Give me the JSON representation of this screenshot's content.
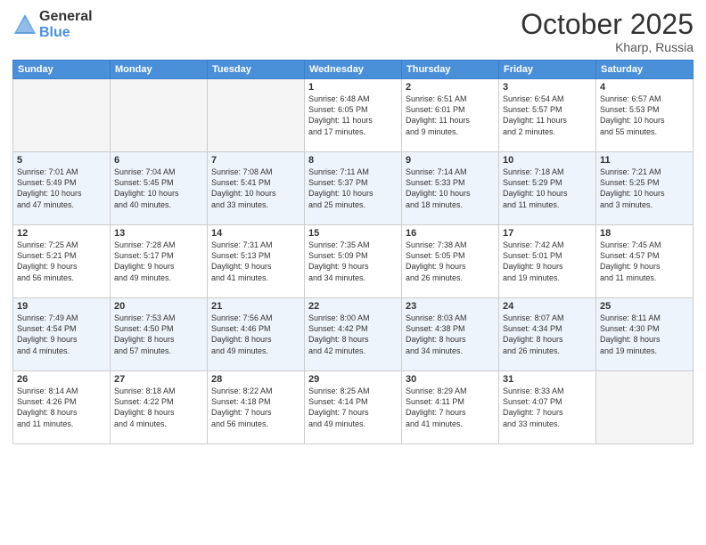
{
  "logo": {
    "general": "General",
    "blue": "Blue"
  },
  "title": "October 2025",
  "subtitle": "Kharp, Russia",
  "days_header": [
    "Sunday",
    "Monday",
    "Tuesday",
    "Wednesday",
    "Thursday",
    "Friday",
    "Saturday"
  ],
  "weeks": [
    {
      "alt": false,
      "days": [
        {
          "num": "",
          "info": ""
        },
        {
          "num": "",
          "info": ""
        },
        {
          "num": "",
          "info": ""
        },
        {
          "num": "1",
          "info": "Sunrise: 6:48 AM\nSunset: 6:05 PM\nDaylight: 11 hours\nand 17 minutes."
        },
        {
          "num": "2",
          "info": "Sunrise: 6:51 AM\nSunset: 6:01 PM\nDaylight: 11 hours\nand 9 minutes."
        },
        {
          "num": "3",
          "info": "Sunrise: 6:54 AM\nSunset: 5:57 PM\nDaylight: 11 hours\nand 2 minutes."
        },
        {
          "num": "4",
          "info": "Sunrise: 6:57 AM\nSunset: 5:53 PM\nDaylight: 10 hours\nand 55 minutes."
        }
      ]
    },
    {
      "alt": true,
      "days": [
        {
          "num": "5",
          "info": "Sunrise: 7:01 AM\nSunset: 5:49 PM\nDaylight: 10 hours\nand 47 minutes."
        },
        {
          "num": "6",
          "info": "Sunrise: 7:04 AM\nSunset: 5:45 PM\nDaylight: 10 hours\nand 40 minutes."
        },
        {
          "num": "7",
          "info": "Sunrise: 7:08 AM\nSunset: 5:41 PM\nDaylight: 10 hours\nand 33 minutes."
        },
        {
          "num": "8",
          "info": "Sunrise: 7:11 AM\nSunset: 5:37 PM\nDaylight: 10 hours\nand 25 minutes."
        },
        {
          "num": "9",
          "info": "Sunrise: 7:14 AM\nSunset: 5:33 PM\nDaylight: 10 hours\nand 18 minutes."
        },
        {
          "num": "10",
          "info": "Sunrise: 7:18 AM\nSunset: 5:29 PM\nDaylight: 10 hours\nand 11 minutes."
        },
        {
          "num": "11",
          "info": "Sunrise: 7:21 AM\nSunset: 5:25 PM\nDaylight: 10 hours\nand 3 minutes."
        }
      ]
    },
    {
      "alt": false,
      "days": [
        {
          "num": "12",
          "info": "Sunrise: 7:25 AM\nSunset: 5:21 PM\nDaylight: 9 hours\nand 56 minutes."
        },
        {
          "num": "13",
          "info": "Sunrise: 7:28 AM\nSunset: 5:17 PM\nDaylight: 9 hours\nand 49 minutes."
        },
        {
          "num": "14",
          "info": "Sunrise: 7:31 AM\nSunset: 5:13 PM\nDaylight: 9 hours\nand 41 minutes."
        },
        {
          "num": "15",
          "info": "Sunrise: 7:35 AM\nSunset: 5:09 PM\nDaylight: 9 hours\nand 34 minutes."
        },
        {
          "num": "16",
          "info": "Sunrise: 7:38 AM\nSunset: 5:05 PM\nDaylight: 9 hours\nand 26 minutes."
        },
        {
          "num": "17",
          "info": "Sunrise: 7:42 AM\nSunset: 5:01 PM\nDaylight: 9 hours\nand 19 minutes."
        },
        {
          "num": "18",
          "info": "Sunrise: 7:45 AM\nSunset: 4:57 PM\nDaylight: 9 hours\nand 11 minutes."
        }
      ]
    },
    {
      "alt": true,
      "days": [
        {
          "num": "19",
          "info": "Sunrise: 7:49 AM\nSunset: 4:54 PM\nDaylight: 9 hours\nand 4 minutes."
        },
        {
          "num": "20",
          "info": "Sunrise: 7:53 AM\nSunset: 4:50 PM\nDaylight: 8 hours\nand 57 minutes."
        },
        {
          "num": "21",
          "info": "Sunrise: 7:56 AM\nSunset: 4:46 PM\nDaylight: 8 hours\nand 49 minutes."
        },
        {
          "num": "22",
          "info": "Sunrise: 8:00 AM\nSunset: 4:42 PM\nDaylight: 8 hours\nand 42 minutes."
        },
        {
          "num": "23",
          "info": "Sunrise: 8:03 AM\nSunset: 4:38 PM\nDaylight: 8 hours\nand 34 minutes."
        },
        {
          "num": "24",
          "info": "Sunrise: 8:07 AM\nSunset: 4:34 PM\nDaylight: 8 hours\nand 26 minutes."
        },
        {
          "num": "25",
          "info": "Sunrise: 8:11 AM\nSunset: 4:30 PM\nDaylight: 8 hours\nand 19 minutes."
        }
      ]
    },
    {
      "alt": false,
      "days": [
        {
          "num": "26",
          "info": "Sunrise: 8:14 AM\nSunset: 4:26 PM\nDaylight: 8 hours\nand 11 minutes."
        },
        {
          "num": "27",
          "info": "Sunrise: 8:18 AM\nSunset: 4:22 PM\nDaylight: 8 hours\nand 4 minutes."
        },
        {
          "num": "28",
          "info": "Sunrise: 8:22 AM\nSunset: 4:18 PM\nDaylight: 7 hours\nand 56 minutes."
        },
        {
          "num": "29",
          "info": "Sunrise: 8:25 AM\nSunset: 4:14 PM\nDaylight: 7 hours\nand 49 minutes."
        },
        {
          "num": "30",
          "info": "Sunrise: 8:29 AM\nSunset: 4:11 PM\nDaylight: 7 hours\nand 41 minutes."
        },
        {
          "num": "31",
          "info": "Sunrise: 8:33 AM\nSunset: 4:07 PM\nDaylight: 7 hours\nand 33 minutes."
        },
        {
          "num": "",
          "info": ""
        }
      ]
    }
  ]
}
